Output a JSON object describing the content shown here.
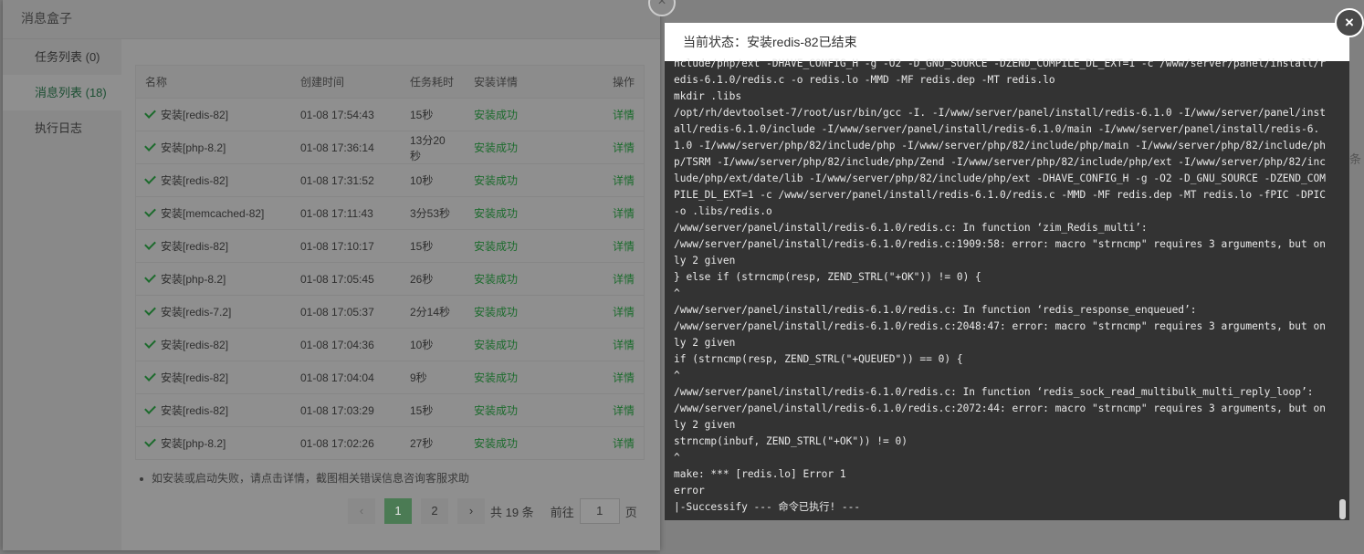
{
  "modal": {
    "title": "消息盒子",
    "sidebar": [
      {
        "label": "任务列表 (0)",
        "active": false
      },
      {
        "label": "消息列表 (18)",
        "active": true
      },
      {
        "label": "执行日志",
        "active": false
      }
    ],
    "table": {
      "headers": [
        "名称",
        "创建时间",
        "任务耗时",
        "安装详情",
        "操作"
      ],
      "rows": [
        {
          "name": "安装[redis-82]",
          "time": "01-08 17:54:43",
          "duration": "15秒",
          "status": "安装成功",
          "action": "详情"
        },
        {
          "name": "安装[php-8.2]",
          "time": "01-08 17:36:14",
          "duration": "13分20秒",
          "status": "安装成功",
          "action": "详情"
        },
        {
          "name": "安装[redis-82]",
          "time": "01-08 17:31:52",
          "duration": "10秒",
          "status": "安装成功",
          "action": "详情"
        },
        {
          "name": "安装[memcached-82]",
          "time": "01-08 17:11:43",
          "duration": "3分53秒",
          "status": "安装成功",
          "action": "详情"
        },
        {
          "name": "安装[redis-82]",
          "time": "01-08 17:10:17",
          "duration": "15秒",
          "status": "安装成功",
          "action": "详情"
        },
        {
          "name": "安装[php-8.2]",
          "time": "01-08 17:05:45",
          "duration": "26秒",
          "status": "安装成功",
          "action": "详情"
        },
        {
          "name": "安装[redis-7.2]",
          "time": "01-08 17:05:37",
          "duration": "2分14秒",
          "status": "安装成功",
          "action": "详情"
        },
        {
          "name": "安装[redis-82]",
          "time": "01-08 17:04:36",
          "duration": "10秒",
          "status": "安装成功",
          "action": "详情"
        },
        {
          "name": "安装[redis-82]",
          "time": "01-08 17:04:04",
          "duration": "9秒",
          "status": "安装成功",
          "action": "详情"
        },
        {
          "name": "安装[redis-82]",
          "time": "01-08 17:03:29",
          "duration": "15秒",
          "status": "安装成功",
          "action": "详情"
        },
        {
          "name": "安装[php-8.2]",
          "time": "01-08 17:02:26",
          "duration": "27秒",
          "status": "安装成功",
          "action": "详情"
        }
      ]
    },
    "tip": "如安装或启动失败，请点击详情，截图相关错误信息咨询客服求助",
    "pager": {
      "prev": "‹",
      "pages": [
        "1",
        "2"
      ],
      "current": "1",
      "next": "›",
      "total": "共 19 条",
      "goto_label": "前往",
      "goto_value": "1",
      "page_unit": "页"
    }
  },
  "log": {
    "status": "当前状态：安装redis-82已结束",
    "lines": [
      "nclude/php/ext -DHAVE_CONFIG_H -g -O2 -D_GNU_SOURCE -DZEND_COMPILE_DL_EXT=1 -c /www/server/panel/install/redis-6.1.0/redis.c -o redis.lo -MMD -MF redis.dep -MT redis.lo",
      "mkdir .libs",
      "/opt/rh/devtoolset-7/root/usr/bin/gcc -I. -I/www/server/panel/install/redis-6.1.0 -I/www/server/panel/install/redis-6.1.0/include -I/www/server/panel/install/redis-6.1.0/main -I/www/server/panel/install/redis-6.1.0 -I/www/server/php/82/include/php -I/www/server/php/82/include/php/main -I/www/server/php/82/include/php/TSRM -I/www/server/php/82/include/php/Zend -I/www/server/php/82/include/php/ext -I/www/server/php/82/include/php/ext/date/lib -I/www/server/php/82/include/php/ext -DHAVE_CONFIG_H -g -O2 -D_GNU_SOURCE -DZEND_COMPILE_DL_EXT=1 -c /www/server/panel/install/redis-6.1.0/redis.c -MMD -MF redis.dep -MT redis.lo -fPIC -DPIC -o .libs/redis.o",
      "/www/server/panel/install/redis-6.1.0/redis.c: In function ‘zim_Redis_multi’:",
      "/www/server/panel/install/redis-6.1.0/redis.c:1909:58: error: macro \"strncmp\" requires 3 arguments, but only 2 given",
      "} else if (strncmp(resp, ZEND_STRL(\"+OK\")) != 0) {",
      "^",
      "/www/server/panel/install/redis-6.1.0/redis.c: In function ‘redis_response_enqueued’:",
      "/www/server/panel/install/redis-6.1.0/redis.c:2048:47: error: macro \"strncmp\" requires 3 arguments, but only 2 given",
      "if (strncmp(resp, ZEND_STRL(\"+QUEUED\")) == 0) {",
      "^",
      "/www/server/panel/install/redis-6.1.0/redis.c: In function ‘redis_sock_read_multibulk_multi_reply_loop’:",
      "/www/server/panel/install/redis-6.1.0/redis.c:2072:44: error: macro \"strncmp\" requires 3 arguments, but only 2 given",
      "strncmp(inbuf, ZEND_STRL(\"+OK\")) != 0)",
      "^",
      "make: *** [redis.lo] Error 1",
      "error",
      "|-Successify --- 命令已执行! ---"
    ]
  },
  "background_hint": "条",
  "colors": {
    "success": "#1b6b2c",
    "active_page": "#4b7b54",
    "log_bg": "#333333"
  }
}
